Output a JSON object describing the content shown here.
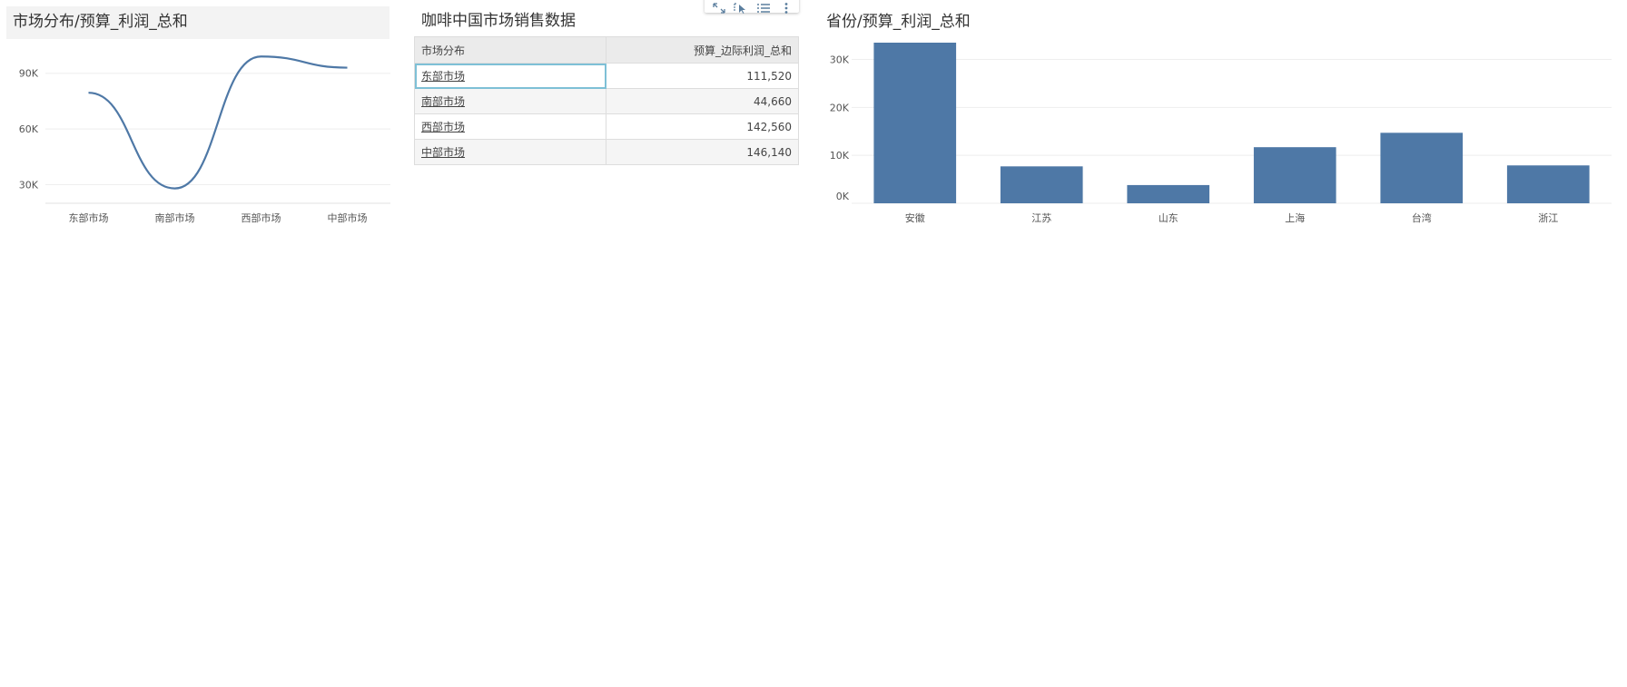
{
  "toolbar": {
    "items": [
      {
        "icon": "expand-icon"
      },
      {
        "icon": "cursor-select-icon"
      },
      {
        "icon": "list-icon"
      },
      {
        "icon": "more-vertical-icon"
      }
    ]
  },
  "line_panel": {
    "title": "市场分布/预算_利润_总和"
  },
  "table_panel": {
    "title": "咖啡中国市场销售数据",
    "headers": [
      "市场分布",
      "预算_边际利润_总和"
    ],
    "rows": [
      [
        "东部市场",
        "111,520"
      ],
      [
        "南部市场",
        "44,660"
      ],
      [
        "西部市场",
        "142,560"
      ],
      [
        "中部市场",
        "146,140"
      ]
    ]
  },
  "bar_panel": {
    "title": "省份/预算_利润_总和"
  },
  "colors": {
    "series": "#4e78a6",
    "grid": "#eeeeee",
    "title_bar": "#f3f3f3",
    "focus": "#7ec0d6"
  },
  "chart_data": [
    {
      "type": "line",
      "title": "市场分布/预算_利润_总和",
      "categories": [
        "东部市场",
        "南部市场",
        "西部市场",
        "中部市场"
      ],
      "values": [
        79500,
        28000,
        99000,
        93000
      ],
      "yticks": [
        "30K",
        "60K",
        "90K"
      ],
      "ytick_values": [
        30000,
        60000,
        90000
      ],
      "ylim": [
        20000,
        105000
      ],
      "grid": true
    },
    {
      "type": "bar",
      "title": "省份/预算_利润_总和",
      "categories": [
        "安徽",
        "江苏",
        "山东",
        "上海",
        "台湾",
        "浙江"
      ],
      "values": [
        33500,
        7700,
        3800,
        11700,
        14700,
        7900
      ],
      "yticks": [
        "0K",
        "10K",
        "20K",
        "30K"
      ],
      "ytick_values": [
        0,
        10000,
        20000,
        30000
      ],
      "ylim": [
        0,
        33500
      ],
      "grid": true
    }
  ]
}
